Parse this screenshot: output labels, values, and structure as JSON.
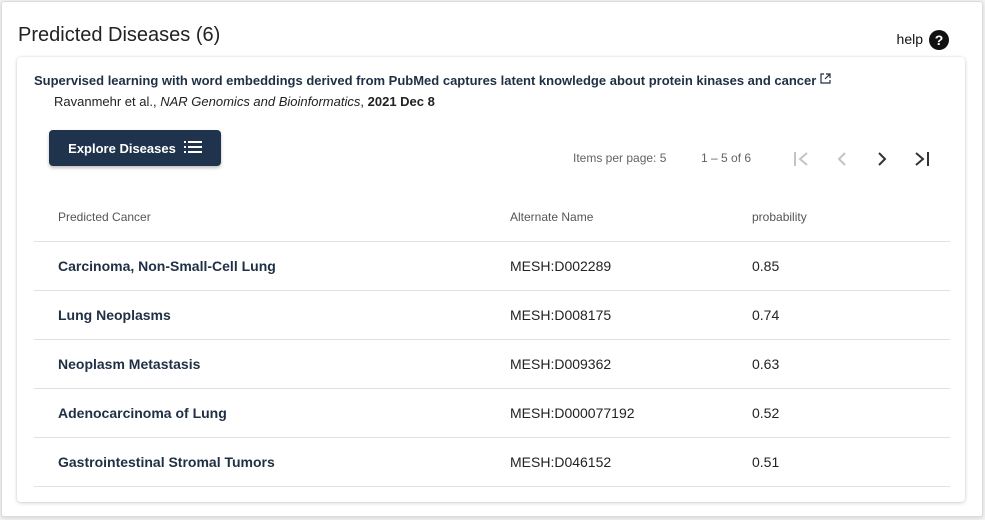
{
  "header": {
    "title": "Predicted Diseases (6)",
    "help_label": "help",
    "help_icon": "question-circle-icon"
  },
  "publication": {
    "title": "Supervised learning with word embeddings derived from PubMed captures latent knowledge about protein kinases and cancer",
    "authors": "Ravanmehr et al.,",
    "journal": "NAR Genomics and Bioinformatics",
    "comma": ",",
    "date": "2021 Dec 8",
    "link_icon": "external-link-icon"
  },
  "explore_button": {
    "label": "Explore Diseases",
    "icon": "list-icon"
  },
  "paginator": {
    "items_per_page_label": "Items per page: 5",
    "range_label": "1 – 5 of 6",
    "first_icon": "first-page-icon",
    "prev_icon": "chevron-left-icon",
    "next_icon": "chevron-right-icon",
    "last_icon": "last-page-icon"
  },
  "table": {
    "columns": [
      "Predicted Cancer",
      "Alternate Name",
      "probability"
    ],
    "rows": [
      {
        "name": "Carcinoma, Non-Small-Cell Lung",
        "alt": "MESH:D002289",
        "prob": "0.85"
      },
      {
        "name": "Lung Neoplasms",
        "alt": "MESH:D008175",
        "prob": "0.74"
      },
      {
        "name": "Neoplasm Metastasis",
        "alt": "MESH:D009362",
        "prob": "0.63"
      },
      {
        "name": "Adenocarcinoma of Lung",
        "alt": "MESH:D000077192",
        "prob": "0.52"
      },
      {
        "name": "Gastrointestinal Stromal Tumors",
        "alt": "MESH:D046152",
        "prob": "0.51"
      }
    ]
  },
  "colors": {
    "accent": "#1f344c",
    "title_text": "#1f2f44"
  }
}
